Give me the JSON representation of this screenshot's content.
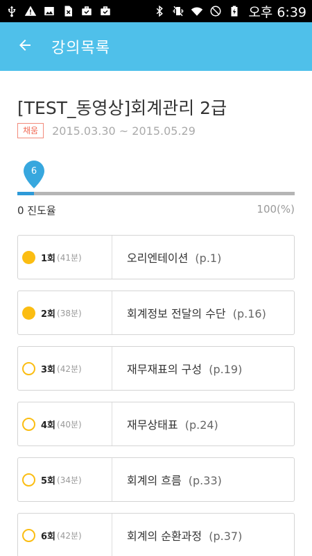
{
  "status_bar": {
    "time": "오후 6:39",
    "icons": [
      "usb-icon",
      "warning-icon",
      "image-icon",
      "sim-off-icon",
      "briefcase-check-icon",
      "briefcase-check-icon",
      "bluetooth-icon",
      "vibrate-icon",
      "wifi-icon",
      "no-disturb-icon",
      "battery-charging-icon"
    ]
  },
  "app_bar": {
    "title": "강의목록",
    "back_icon": "arrow-left-icon"
  },
  "course": {
    "title": "[TEST_동영상]회계관리 2급",
    "badge": "채움",
    "date_range": "2015.03.30 ~ 2015.05.29"
  },
  "progress": {
    "value_label": "6",
    "percent": 6,
    "min_label": "0 진도율",
    "max_label": "100(%)",
    "colors": {
      "fill": "#2e9ad8",
      "track": "#b5b5b5",
      "pin": "#37a7de"
    }
  },
  "lessons": [
    {
      "number": "1회",
      "duration": "(41분)",
      "title": "오리엔테이션",
      "page": "(p.1)",
      "completed": true
    },
    {
      "number": "2회",
      "duration": "(38분)",
      "title": "회계정보 전달의 수단",
      "page": "(p.16)",
      "completed": true
    },
    {
      "number": "3회",
      "duration": "(42분)",
      "title": "재무재표의 구성",
      "page": "(p.19)",
      "completed": false
    },
    {
      "number": "4회",
      "duration": "(40분)",
      "title": "재무상태표",
      "page": "(p.24)",
      "completed": false
    },
    {
      "number": "5회",
      "duration": "(34분)",
      "title": "회계의 흐름",
      "page": "(p.33)",
      "completed": false
    },
    {
      "number": "6회",
      "duration": "(42분)",
      "title": "회계의 순환과정",
      "page": "(p.37)",
      "completed": false
    }
  ],
  "colors": {
    "app_bar": "#4fc0ea",
    "status_done": "#fbbd12",
    "badge": "#f06a55"
  }
}
